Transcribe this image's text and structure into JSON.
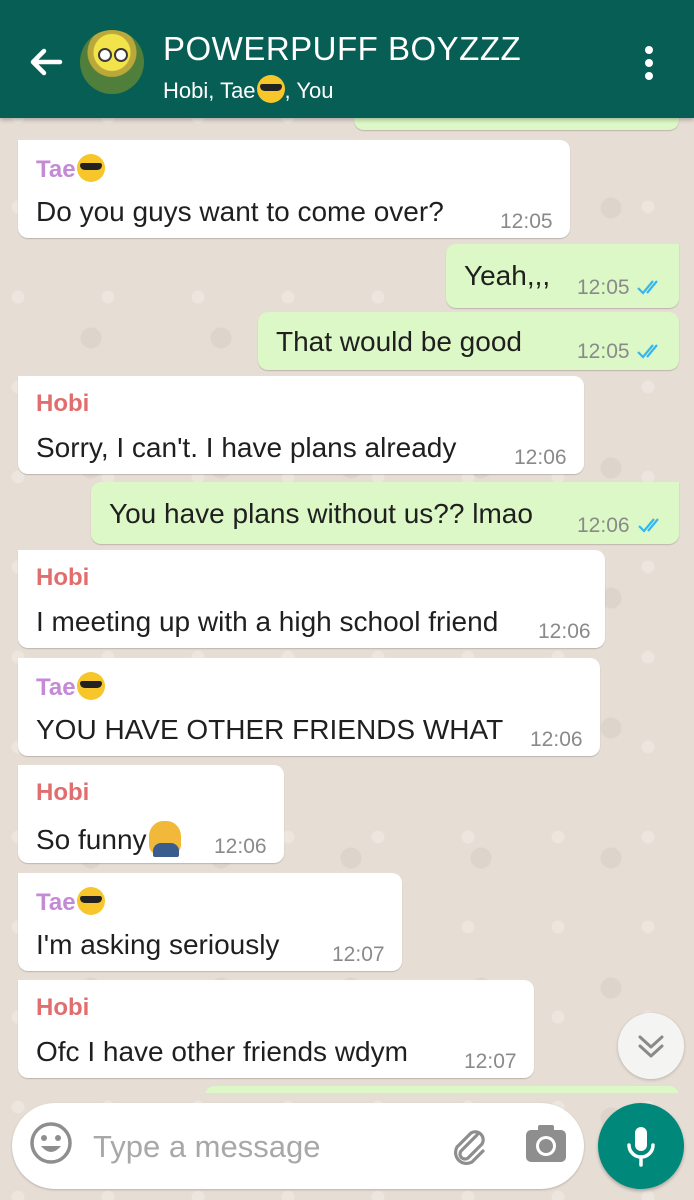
{
  "header": {
    "title": "POWERPUFF BOYZZZ",
    "subtitle_prefix": "Hobi, Tae",
    "subtitle_suffix": ", You"
  },
  "colors": {
    "header": "#075e54",
    "incoming": "#ffffff",
    "outgoing": "#dcf8c6",
    "tae": "#c58ad6",
    "hobi": "#e16e6e",
    "tick": "#34b7f1",
    "mic": "#00897b"
  },
  "messages": [
    {
      "sender": "Tae",
      "text": "Do you guys want to come over?",
      "time": "12:05"
    },
    {
      "text": "Yeah,,,",
      "time": "12:05"
    },
    {
      "text": "That would be good",
      "time": "12:05"
    },
    {
      "sender": "Hobi",
      "text": "Sorry, I can't. I have plans already",
      "time": "12:06"
    },
    {
      "text": "You have plans without us?? lmao",
      "time": "12:06"
    },
    {
      "sender": "Hobi",
      "text": "I meeting up with a high school friend",
      "time": "12:06"
    },
    {
      "sender": "Tae",
      "text": "YOU HAVE OTHER FRIENDS WHAT",
      "time": "12:06"
    },
    {
      "sender": "Hobi",
      "text": "So funny",
      "time": "12:06"
    },
    {
      "sender": "Tae",
      "text": "I'm asking seriously",
      "time": "12:07"
    },
    {
      "sender": "Hobi",
      "text": "Ofc I have other friends wdym",
      "time": "12:07"
    }
  ],
  "input": {
    "placeholder": "Type a message"
  }
}
